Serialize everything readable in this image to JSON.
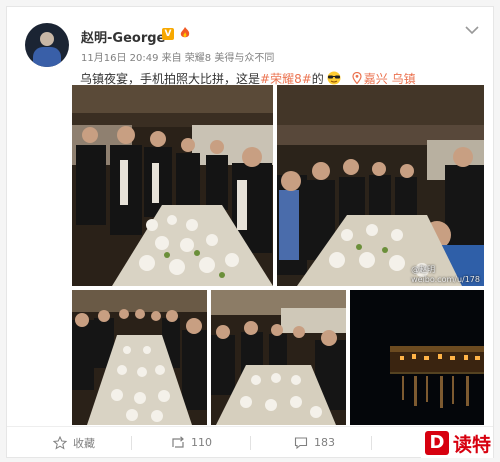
{
  "post": {
    "author": "赵明-George",
    "badge": "V",
    "meta": "11月16日 20:49 来自 荣耀8 美得与众不同",
    "text_prefix": "乌镇夜宴，手机拍照大比拼，这是",
    "topic": "#荣耀8#",
    "text_suffix": "的",
    "location": "嘉兴 乌镇"
  },
  "watermarks": {
    "photo1": "@赵明",
    "photo2": "weibo.com/u/178"
  },
  "actions": {
    "favorite": "收藏",
    "repost": "110",
    "comment": "183"
  },
  "brand": {
    "logo_letter": "D",
    "name": "读特"
  },
  "colors": {
    "link": "#eb7350",
    "brand": "#d7000f"
  }
}
